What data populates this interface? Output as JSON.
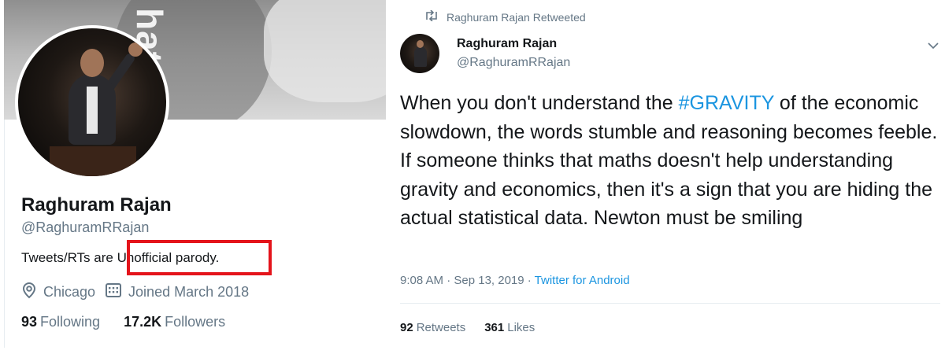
{
  "profile": {
    "banner_text": "hat I do",
    "name": "Raghuram Rajan",
    "handle": "@RaghuramRRajan",
    "bio": "Tweets/RTs are Unofficial parody.",
    "location": "Chicago",
    "joined": "Joined March 2018",
    "following_count": "93",
    "following_label": "Following",
    "followers_count": "17.2K",
    "followers_label": "Followers",
    "highlight_color": "#e4141b"
  },
  "tweet": {
    "retweeted_by": "Raghuram Rajan Retweeted",
    "author_name": "Raghuram Rajan",
    "author_handle": "@RaghuramRRajan",
    "text_before": "When you don't understand the ",
    "hashtag": "#GRAVITY",
    "text_after": " of the economic slowdown, the words stumble and reasoning becomes feeble. If someone thinks that maths doesn't help understanding gravity and economics, then it's a sign that you are hiding the actual statistical data. Newton must be smiling",
    "timestamp": "9:08 AM · Sep 13, 2019 · ",
    "source": "Twitter for Android",
    "retweets_count": "92",
    "retweets_label": "Retweets",
    "likes_count": "361",
    "likes_label": "Likes"
  },
  "colors": {
    "link": "#1b95e0",
    "secondary_text": "#657786",
    "primary_text": "#14171a"
  },
  "icons": {
    "location": "location-pin-icon",
    "calendar": "calendar-icon",
    "retweet": "retweet-icon",
    "chevron": "chevron-down-icon"
  }
}
